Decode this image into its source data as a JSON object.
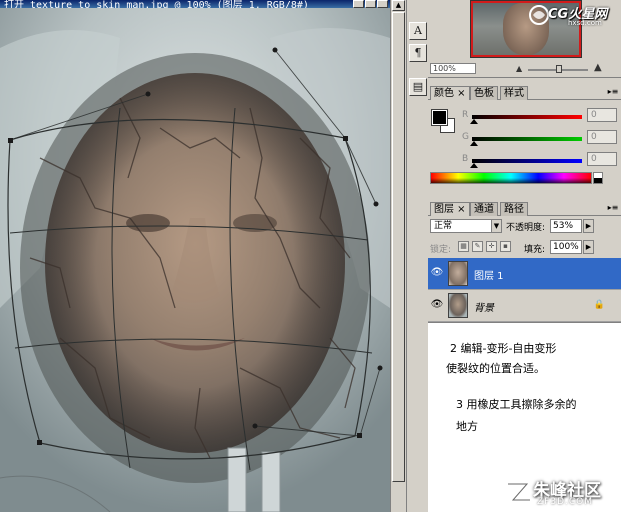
{
  "document": {
    "title": "打开 texture_to_skin_man.jpg @ 100% (图层 1, RGB/8#)"
  },
  "dock": {
    "icons": [
      "text-type-icon",
      "paragraph-icon",
      "history-icon"
    ],
    "glyphs": [
      "A",
      "¶",
      "▤"
    ]
  },
  "navigator": {
    "zoom": "100%"
  },
  "logo": {
    "text": "CG火星网",
    "sub": "hxsd.com"
  },
  "color_panel": {
    "tabs": [
      "颜色 ×",
      "色板",
      "样式"
    ],
    "channels": [
      {
        "label": "R",
        "value": "0",
        "color_from": "#000000",
        "color_to": "#ff0000"
      },
      {
        "label": "G",
        "value": "0",
        "color_from": "#000000",
        "color_to": "#00ff00"
      },
      {
        "label": "B",
        "value": "0",
        "color_from": "#000000",
        "color_to": "#0000ff"
      }
    ],
    "foreground": "#000000",
    "background": "#ffffff"
  },
  "layers_panel": {
    "tabs": [
      "图层 ×",
      "通道",
      "路径"
    ],
    "blend_mode": "正常",
    "opacity_label": "不透明度:",
    "opacity": "53%",
    "lock_label": "锁定:",
    "fill_label": "填充:",
    "fill": "100%",
    "layers": [
      {
        "name": "图层 1",
        "selected": true
      },
      {
        "name": "背景",
        "selected": false,
        "locked": true
      }
    ]
  },
  "notes": {
    "step2_line1": "2  编辑-变形-自由变形",
    "step2_line2": "使裂纹的位置合适。",
    "step3_line1": "3 用橡皮工具擦除多余的",
    "step3_line2": "地方"
  },
  "watermark": {
    "main": "朱峰社区",
    "sub": "ZF3D.COM"
  },
  "colors": {
    "selection_blue": "#3169c6",
    "panel_gray": "#d4d0c8",
    "nav_red": "#d21b1b"
  }
}
